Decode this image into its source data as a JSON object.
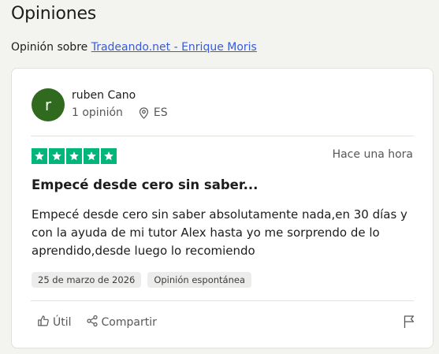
{
  "section": {
    "heading": "Opiniones"
  },
  "about": {
    "prefix": "Opinión sobre ",
    "link_text": "Tradeando.net - Enrique Moris"
  },
  "review": {
    "avatar_letter": "r",
    "author_name": "ruben Cano",
    "review_count": "1 opinión",
    "country": "ES",
    "rating": 5,
    "time_ago": "Hace una hora",
    "title": "Empecé desde cero sin saber...",
    "body": "Empecé desde cero sin saber absolutamente nada,en 30 días y con la ayuda de mi tutor Alex hasta yo me sorprendo de lo aprendido,desde luego lo recomiendo",
    "date_tag": "25 de marzo de 2026",
    "type_tag": "Opinión espontánea",
    "useful_label": "Útil",
    "share_label": "Compartir"
  },
  "colors": {
    "star": "#00b67a",
    "avatar": "#2f6a1f",
    "link": "#3a5bd9"
  }
}
